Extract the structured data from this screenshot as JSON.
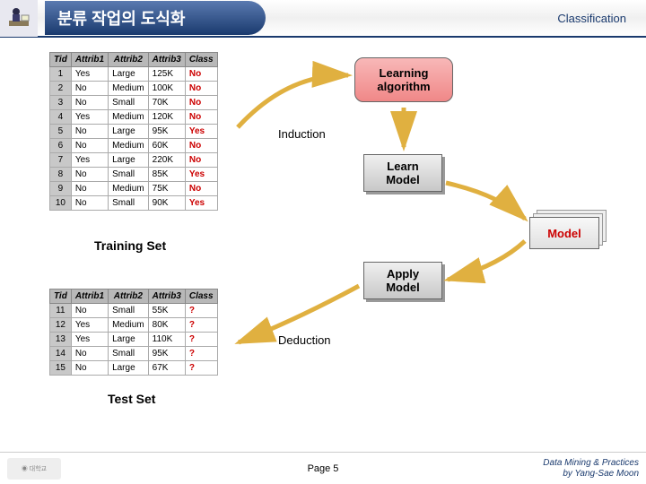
{
  "header": {
    "title": "분류 작업의 도식화",
    "right": "Classification",
    "icon": "person-desk-icon"
  },
  "training": {
    "caption": "Training Set",
    "headers": [
      "Tid",
      "Attrib1",
      "Attrib2",
      "Attrib3",
      "Class"
    ],
    "rows": [
      [
        "1",
        "Yes",
        "Large",
        "125K",
        "No"
      ],
      [
        "2",
        "No",
        "Medium",
        "100K",
        "No"
      ],
      [
        "3",
        "No",
        "Small",
        "70K",
        "No"
      ],
      [
        "4",
        "Yes",
        "Medium",
        "120K",
        "No"
      ],
      [
        "5",
        "No",
        "Large",
        "95K",
        "Yes"
      ],
      [
        "6",
        "No",
        "Medium",
        "60K",
        "No"
      ],
      [
        "7",
        "Yes",
        "Large",
        "220K",
        "No"
      ],
      [
        "8",
        "No",
        "Small",
        "85K",
        "Yes"
      ],
      [
        "9",
        "No",
        "Medium",
        "75K",
        "No"
      ],
      [
        "10",
        "No",
        "Small",
        "90K",
        "Yes"
      ]
    ]
  },
  "test": {
    "caption": "Test Set",
    "headers": [
      "Tid",
      "Attrib1",
      "Attrib2",
      "Attrib3",
      "Class"
    ],
    "rows": [
      [
        "11",
        "No",
        "Small",
        "55K",
        "?"
      ],
      [
        "12",
        "Yes",
        "Medium",
        "80K",
        "?"
      ],
      [
        "13",
        "Yes",
        "Large",
        "110K",
        "?"
      ],
      [
        "14",
        "No",
        "Small",
        "95K",
        "?"
      ],
      [
        "15",
        "No",
        "Large",
        "67K",
        "?"
      ]
    ]
  },
  "boxes": {
    "learning": "Learning\nalgorithm",
    "learn": "Learn\nModel",
    "apply": "Apply\nModel",
    "model": "Model"
  },
  "labels": {
    "induction": "Induction",
    "deduction": "Deduction"
  },
  "footer": {
    "page": "Page 5",
    "right1": "Data Mining & Practices",
    "right2": "by Yang-Sae Moon",
    "logo": "univ-logo"
  }
}
